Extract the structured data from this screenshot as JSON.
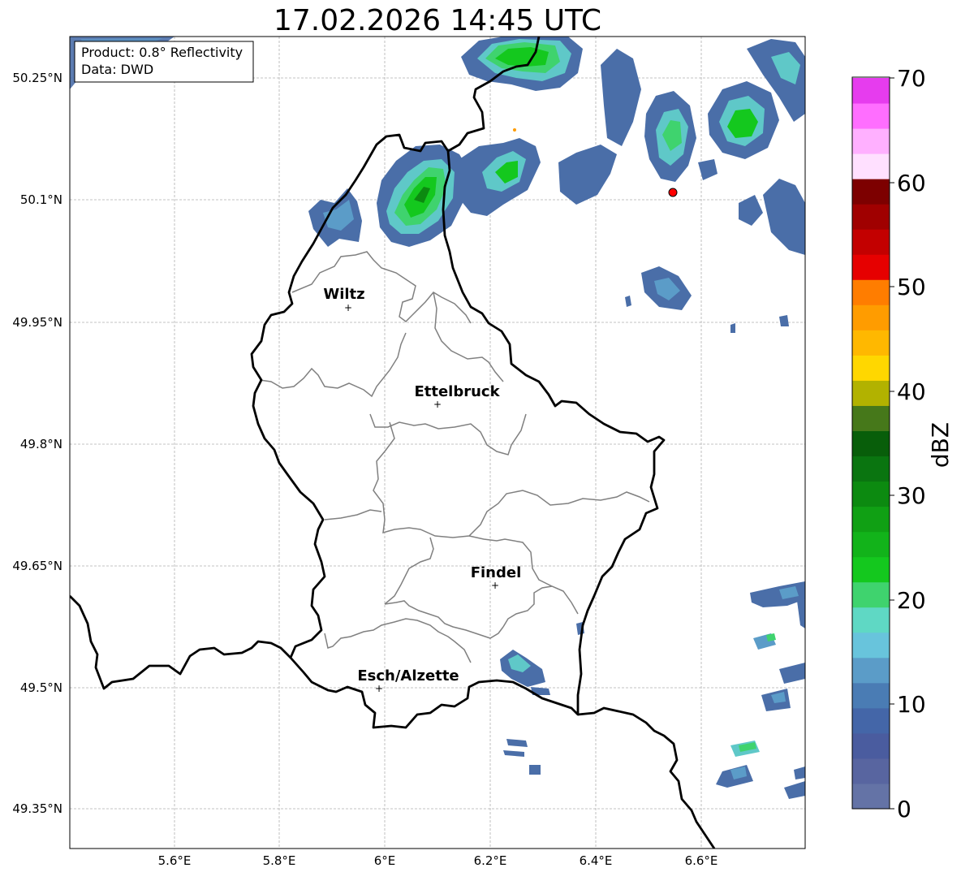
{
  "title": "17.02.2026 14:45 UTC",
  "info_box": {
    "product": "Product: 0.8° Reflectivity",
    "data": "Data: DWD"
  },
  "lat_ticks": [
    "50.25°N",
    "50.1°N",
    "49.95°N",
    "49.8°N",
    "49.65°N",
    "49.5°N",
    "49.35°N"
  ],
  "lon_ticks": [
    "5.6°E",
    "5.8°E",
    "6°E",
    "6.2°E",
    "6.4°E",
    "6.6°E"
  ],
  "cities": [
    {
      "name": "Wiltz"
    },
    {
      "name": "Ettelbruck"
    },
    {
      "name": "Findel"
    },
    {
      "name": "Esch/Alzette"
    }
  ],
  "colorbar": {
    "label": "dBZ",
    "ticks": [
      "70",
      "60",
      "50",
      "40",
      "30",
      "20",
      "10",
      "0"
    ],
    "colors_bottom_to_top": [
      "#6473a6",
      "#5865a0",
      "#4a5c9f",
      "#4466a8",
      "#4a7cb4",
      "#5b9cc8",
      "#68c4dc",
      "#5fd8c4",
      "#3fd36e",
      "#14c81e",
      "#12b31a",
      "#10a014",
      "#0c8a10",
      "#0a7510",
      "#085e0a",
      "#46781a",
      "#b2b200",
      "#ffd700",
      "#ffb800",
      "#ff9c00",
      "#ff7d00",
      "#e60000",
      "#c30000",
      "#a00000",
      "#7d0000",
      "#ffe0ff",
      "#ffb0ff",
      "#ff6eff",
      "#e63cee"
    ]
  },
  "legend_colors": {
    "border": "#000000",
    "region": "#808080",
    "radar_site": "#ff0000"
  }
}
